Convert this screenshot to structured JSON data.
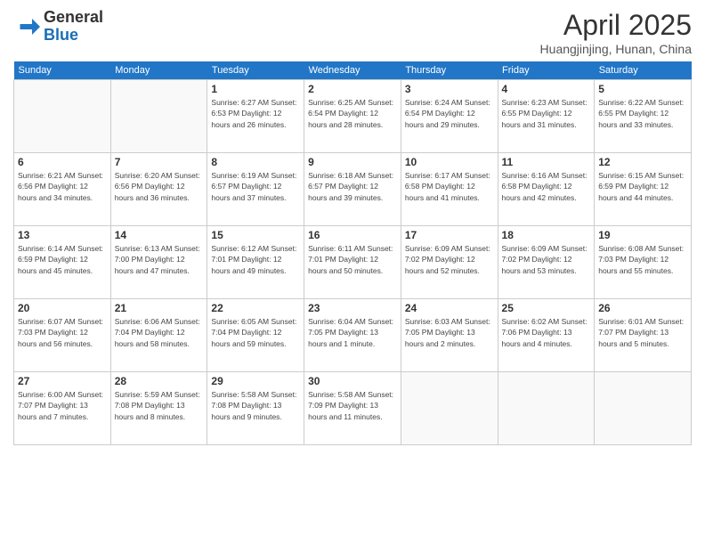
{
  "logo": {
    "general": "General",
    "blue": "Blue"
  },
  "title": "April 2025",
  "location": "Huangjinjing, Hunan, China",
  "weekdays": [
    "Sunday",
    "Monday",
    "Tuesday",
    "Wednesday",
    "Thursday",
    "Friday",
    "Saturday"
  ],
  "weeks": [
    [
      {
        "day": "",
        "info": ""
      },
      {
        "day": "",
        "info": ""
      },
      {
        "day": "1",
        "info": "Sunrise: 6:27 AM\nSunset: 6:53 PM\nDaylight: 12 hours\nand 26 minutes."
      },
      {
        "day": "2",
        "info": "Sunrise: 6:25 AM\nSunset: 6:54 PM\nDaylight: 12 hours\nand 28 minutes."
      },
      {
        "day": "3",
        "info": "Sunrise: 6:24 AM\nSunset: 6:54 PM\nDaylight: 12 hours\nand 29 minutes."
      },
      {
        "day": "4",
        "info": "Sunrise: 6:23 AM\nSunset: 6:55 PM\nDaylight: 12 hours\nand 31 minutes."
      },
      {
        "day": "5",
        "info": "Sunrise: 6:22 AM\nSunset: 6:55 PM\nDaylight: 12 hours\nand 33 minutes."
      }
    ],
    [
      {
        "day": "6",
        "info": "Sunrise: 6:21 AM\nSunset: 6:56 PM\nDaylight: 12 hours\nand 34 minutes."
      },
      {
        "day": "7",
        "info": "Sunrise: 6:20 AM\nSunset: 6:56 PM\nDaylight: 12 hours\nand 36 minutes."
      },
      {
        "day": "8",
        "info": "Sunrise: 6:19 AM\nSunset: 6:57 PM\nDaylight: 12 hours\nand 37 minutes."
      },
      {
        "day": "9",
        "info": "Sunrise: 6:18 AM\nSunset: 6:57 PM\nDaylight: 12 hours\nand 39 minutes."
      },
      {
        "day": "10",
        "info": "Sunrise: 6:17 AM\nSunset: 6:58 PM\nDaylight: 12 hours\nand 41 minutes."
      },
      {
        "day": "11",
        "info": "Sunrise: 6:16 AM\nSunset: 6:58 PM\nDaylight: 12 hours\nand 42 minutes."
      },
      {
        "day": "12",
        "info": "Sunrise: 6:15 AM\nSunset: 6:59 PM\nDaylight: 12 hours\nand 44 minutes."
      }
    ],
    [
      {
        "day": "13",
        "info": "Sunrise: 6:14 AM\nSunset: 6:59 PM\nDaylight: 12 hours\nand 45 minutes."
      },
      {
        "day": "14",
        "info": "Sunrise: 6:13 AM\nSunset: 7:00 PM\nDaylight: 12 hours\nand 47 minutes."
      },
      {
        "day": "15",
        "info": "Sunrise: 6:12 AM\nSunset: 7:01 PM\nDaylight: 12 hours\nand 49 minutes."
      },
      {
        "day": "16",
        "info": "Sunrise: 6:11 AM\nSunset: 7:01 PM\nDaylight: 12 hours\nand 50 minutes."
      },
      {
        "day": "17",
        "info": "Sunrise: 6:09 AM\nSunset: 7:02 PM\nDaylight: 12 hours\nand 52 minutes."
      },
      {
        "day": "18",
        "info": "Sunrise: 6:09 AM\nSunset: 7:02 PM\nDaylight: 12 hours\nand 53 minutes."
      },
      {
        "day": "19",
        "info": "Sunrise: 6:08 AM\nSunset: 7:03 PM\nDaylight: 12 hours\nand 55 minutes."
      }
    ],
    [
      {
        "day": "20",
        "info": "Sunrise: 6:07 AM\nSunset: 7:03 PM\nDaylight: 12 hours\nand 56 minutes."
      },
      {
        "day": "21",
        "info": "Sunrise: 6:06 AM\nSunset: 7:04 PM\nDaylight: 12 hours\nand 58 minutes."
      },
      {
        "day": "22",
        "info": "Sunrise: 6:05 AM\nSunset: 7:04 PM\nDaylight: 12 hours\nand 59 minutes."
      },
      {
        "day": "23",
        "info": "Sunrise: 6:04 AM\nSunset: 7:05 PM\nDaylight: 13 hours\nand 1 minute."
      },
      {
        "day": "24",
        "info": "Sunrise: 6:03 AM\nSunset: 7:05 PM\nDaylight: 13 hours\nand 2 minutes."
      },
      {
        "day": "25",
        "info": "Sunrise: 6:02 AM\nSunset: 7:06 PM\nDaylight: 13 hours\nand 4 minutes."
      },
      {
        "day": "26",
        "info": "Sunrise: 6:01 AM\nSunset: 7:07 PM\nDaylight: 13 hours\nand 5 minutes."
      }
    ],
    [
      {
        "day": "27",
        "info": "Sunrise: 6:00 AM\nSunset: 7:07 PM\nDaylight: 13 hours\nand 7 minutes."
      },
      {
        "day": "28",
        "info": "Sunrise: 5:59 AM\nSunset: 7:08 PM\nDaylight: 13 hours\nand 8 minutes."
      },
      {
        "day": "29",
        "info": "Sunrise: 5:58 AM\nSunset: 7:08 PM\nDaylight: 13 hours\nand 9 minutes."
      },
      {
        "day": "30",
        "info": "Sunrise: 5:58 AM\nSunset: 7:09 PM\nDaylight: 13 hours\nand 11 minutes."
      },
      {
        "day": "",
        "info": ""
      },
      {
        "day": "",
        "info": ""
      },
      {
        "day": "",
        "info": ""
      }
    ]
  ]
}
